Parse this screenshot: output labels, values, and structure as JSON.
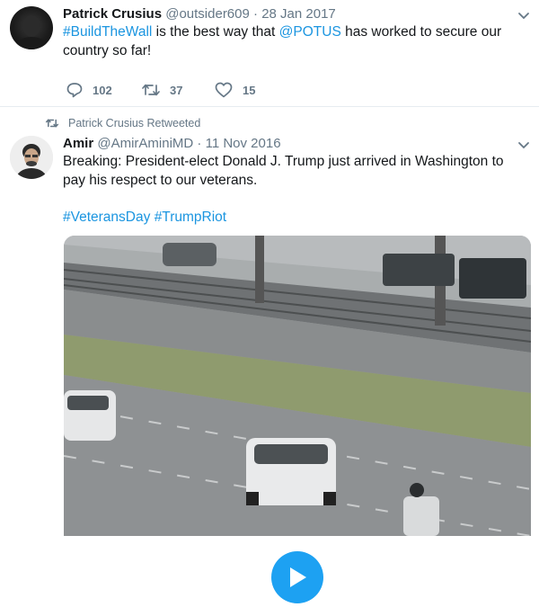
{
  "tweet1": {
    "name": "Patrick Crusius",
    "handle": "@outsider609",
    "sep": "·",
    "date": "28 Jan 2017",
    "text_hashtag": "#BuildTheWall",
    "text_part1": " is the best way that ",
    "text_mention": "@POTUS",
    "text_part2": " has worked to secure our country so far!",
    "replies": "102",
    "retweets": "37",
    "likes": "15"
  },
  "tweet2": {
    "retweet_context": "Patrick Crusius Retweeted",
    "name": "Amir",
    "handle": "@AmirAminiMD",
    "sep": "·",
    "date": "11 Nov 2016",
    "text": "Breaking: President-elect Donald J. Trump just arrived in Washington to pay his respect to our veterans.",
    "hashtag1": "#VeteransDay",
    "hashtag2": "#TrumpRiot"
  },
  "colors": {
    "link": "#1b95e0",
    "muted": "#657786",
    "play_button": "#1da1f2"
  },
  "icons": {
    "reply": "reply-icon",
    "retweet": "retweet-icon",
    "like": "heart-icon",
    "caret": "chevron-down-icon",
    "play": "play-icon"
  }
}
